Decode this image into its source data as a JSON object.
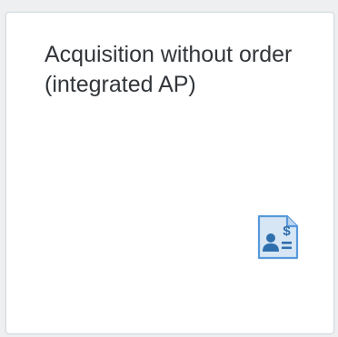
{
  "tile": {
    "title": "Acquisition without order (integrated AP)",
    "icon": "customer-financial-fact-sheet-icon",
    "colors": {
      "background": "#ffffff",
      "border": "#d3dbe3",
      "text": "#32363a",
      "icon": "#5899da"
    }
  }
}
